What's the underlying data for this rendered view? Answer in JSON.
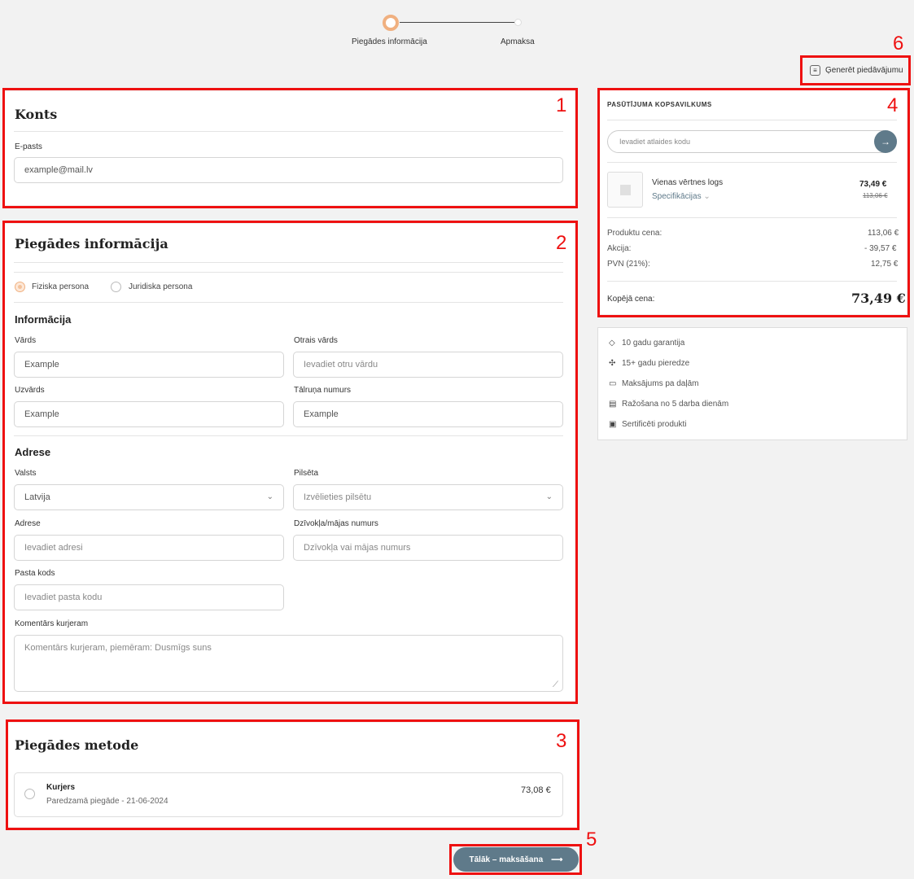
{
  "stepper": {
    "steps": [
      "Piegādes informācija",
      "Apmaksa"
    ]
  },
  "annotations": [
    "1",
    "2",
    "3",
    "4",
    "5",
    "6"
  ],
  "generate_quote_label": "Ģenerēt piedāvājumu",
  "account": {
    "title": "Konts",
    "email_label": "E-pasts",
    "email_value": "example@mail.lv"
  },
  "delivery_info": {
    "title": "Piegādes informācija",
    "person_types": [
      "Fiziska persona",
      "Juridiska persona"
    ],
    "selected_person_type": "Fiziska persona",
    "info_heading": "Informācija",
    "first_name_label": "Vārds",
    "first_name_value": "Example",
    "middle_name_label": "Otrais vārds",
    "middle_name_placeholder": "Ievadiet otru vārdu",
    "last_name_label": "Uzvārds",
    "last_name_value": "Example",
    "phone_label": "Tālruņa numurs",
    "phone_value": "Example",
    "address_heading": "Adrese",
    "country_label": "Valsts",
    "country_value": "Latvija",
    "city_label": "Pilsēta",
    "city_placeholder": "Izvēlieties pilsētu",
    "address_label": "Adrese",
    "address_placeholder": "Ievadiet adresi",
    "apartment_label": "Dzīvokļa/mājas numurs",
    "apartment_placeholder": "Dzīvokļa vai mājas numurs",
    "postal_label": "Pasta kods",
    "postal_placeholder": "Ievadiet pasta kodu",
    "comment_label": "Komentārs kurjeram",
    "comment_placeholder": "Komentārs kurjeram, piemēram: Dusmīgs suns"
  },
  "delivery_method": {
    "title": "Piegādes metode",
    "option_name": "Kurjers",
    "option_sub": "Paredzamā piegāde - 21-06-2024",
    "option_price": "73,08 €"
  },
  "next_button_label": "Tālāk – maksāšana",
  "summary": {
    "title": "PASŪTĪJUMA KOPSAVILKUMS",
    "discount_placeholder": "Ievadiet atlaides kodu",
    "product_name": "Vienas vērtnes logs",
    "product_specs": "Specifikācijas",
    "product_price": "73,49 €",
    "product_old_price": "113,06 €",
    "rows": [
      {
        "label": "Produktu cena:",
        "value": "113,06 €"
      },
      {
        "label": "Akcija:",
        "value": "- 39,57 €"
      },
      {
        "label": "PVN (21%):",
        "value": "12,75 €"
      }
    ],
    "total_label": "Kopējā cena:",
    "total_value": "73,49 €"
  },
  "features": [
    {
      "icon": "shield-icon",
      "text": "10 gadu garantija"
    },
    {
      "icon": "handshake-icon",
      "text": "15+ gadu pieredze"
    },
    {
      "icon": "money-icon",
      "text": "Maksājums pa daļām"
    },
    {
      "icon": "factory-icon",
      "text": "Ražošana no 5 darba dienām"
    },
    {
      "icon": "certificate-icon",
      "text": "Sertificēti produkti"
    }
  ],
  "colors": {
    "accent": "#f0b080",
    "button": "#5f7a8a",
    "highlight": "#ee1111"
  }
}
